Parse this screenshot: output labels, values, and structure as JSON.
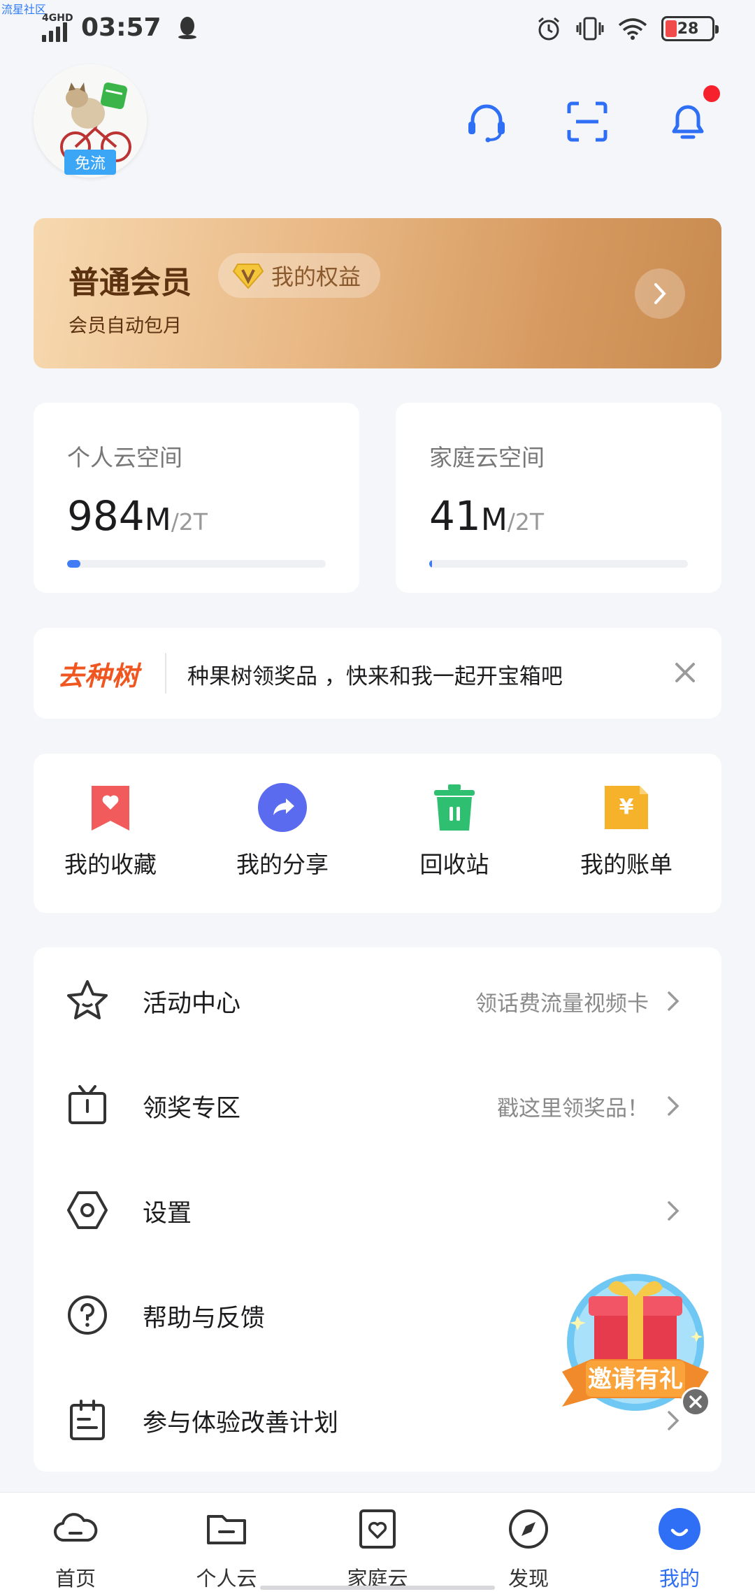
{
  "watermark": "流星社区",
  "status_bar": {
    "network": "4GHD",
    "time": "03:57",
    "battery": "28",
    "battery_level": 0.28
  },
  "header": {
    "avatar_badge": "免流",
    "icons": [
      "headset-icon",
      "scan-icon",
      "bell-icon"
    ],
    "has_notification": true
  },
  "member_card": {
    "title": "普通会员",
    "benefits_label": "我的权益",
    "subtitle": "会员自动包月",
    "colors": {
      "text": "#5c3210",
      "gradient_start": "#f7d9b0",
      "gradient_end": "#c88a4f"
    }
  },
  "storage": {
    "personal": {
      "label": "个人云空间",
      "used_num": "984",
      "used_unit": "M",
      "total": "/2T",
      "fill_percent": 0.05
    },
    "family": {
      "label": "家庭云空间",
      "used_num": "41",
      "used_unit": "M",
      "total": "/2T",
      "fill_percent": 0.002
    }
  },
  "banner": {
    "logo": "去种树",
    "text": "种果树领奖品 ，快来和我一起开宝箱吧"
  },
  "quick_actions": [
    {
      "label": "我的收藏",
      "icon": "bookmark-heart-icon",
      "color": "#f25b5b"
    },
    {
      "label": "我的分享",
      "icon": "share-icon",
      "color": "#5b6bf0"
    },
    {
      "label": "回收站",
      "icon": "trash-icon",
      "color": "#2fbf71"
    },
    {
      "label": "我的账单",
      "icon": "bill-icon",
      "color": "#f7b22b"
    }
  ],
  "menu": [
    {
      "label": "活动中心",
      "hint": "领话费流量视频卡",
      "icon": "star-icon"
    },
    {
      "label": "领奖专区",
      "hint": "戳这里领奖品！",
      "icon": "tv-gift-icon"
    },
    {
      "label": "设置",
      "hint": "",
      "icon": "settings-icon"
    },
    {
      "label": "帮助与反馈",
      "hint": "",
      "icon": "help-icon"
    },
    {
      "label": "参与体验改善计划",
      "hint": "",
      "icon": "clipboard-icon"
    }
  ],
  "invite": {
    "text": "邀请有礼"
  },
  "bottom_nav": [
    {
      "label": "首页",
      "icon": "cloud-icon",
      "active": false
    },
    {
      "label": "个人云",
      "icon": "folder-icon",
      "active": false
    },
    {
      "label": "家庭云",
      "icon": "family-cloud-icon",
      "active": false
    },
    {
      "label": "发现",
      "icon": "compass-icon",
      "active": false
    },
    {
      "label": "我的",
      "icon": "profile-icon",
      "active": true
    }
  ],
  "accent_color": "#2f6ff5"
}
